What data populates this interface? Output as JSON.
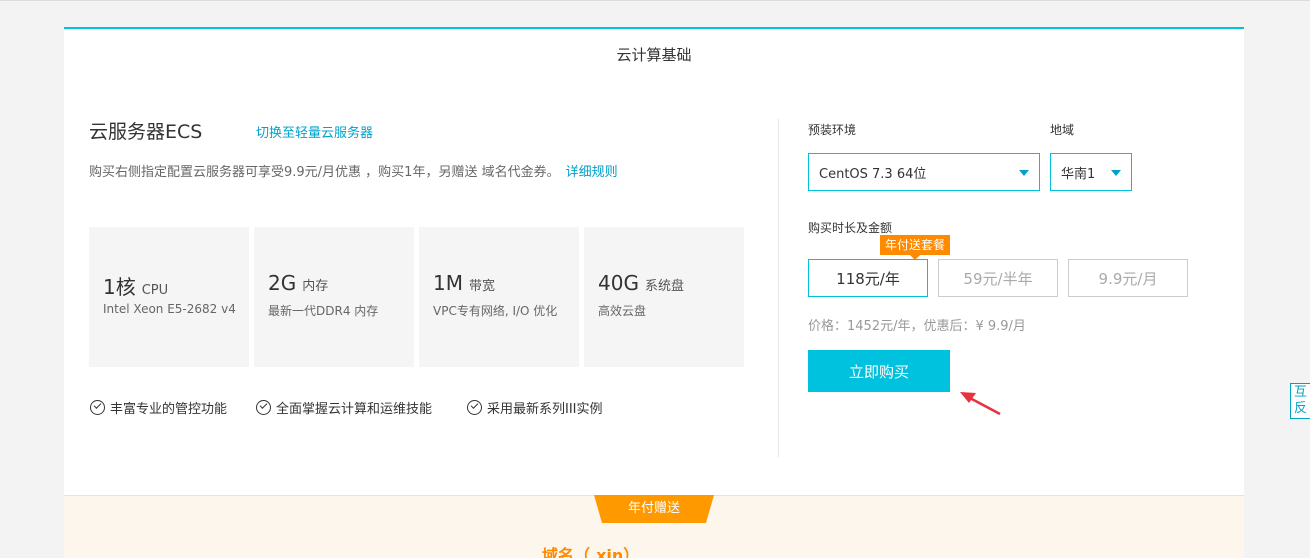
{
  "header": {
    "title": "云计算基础"
  },
  "product": {
    "name": "云服务器ECS",
    "switch_link": "切换至轻量云服务器",
    "promo_text": "购买右侧指定配置云服务器可享受9.9元/月优惠 ，购买1年，另赠送 域名代金券。",
    "promo_link": "详细规则"
  },
  "specs": [
    {
      "value": "1核",
      "unit": "CPU",
      "desc": "Intel Xeon E5-2682 v4"
    },
    {
      "value": "2G",
      "unit": "内存",
      "desc": "最新一代DDR4 内存"
    },
    {
      "value": "1M",
      "unit": "带宽",
      "desc": "VPC专有网络, I/O 优化"
    },
    {
      "value": "40G",
      "unit": "系统盘",
      "desc": "高效云盘"
    }
  ],
  "features": [
    "丰富专业的管控功能",
    "全面掌握云计算和运维技能",
    "采用最新系列III实例"
  ],
  "config": {
    "os_label": "预装环境",
    "os_value": "CentOS 7.3 64位",
    "region_label": "地域",
    "region_value": "华南1",
    "duration_label": "购买时长及金额",
    "badge": "年付送套餐",
    "durations": [
      {
        "label": "118元/年",
        "selected": true
      },
      {
        "label": "59元/半年",
        "selected": false
      },
      {
        "label": "9.9元/月",
        "selected": false
      }
    ],
    "price_line": "价格：1452元/年，优惠后：¥ 9.9/月",
    "buy_button": "立即购买"
  },
  "bottom": {
    "ribbon": "年付赠送",
    "domain": "域名（.xin）"
  },
  "side_tab": "互反",
  "colors": {
    "accent": "#00c1de",
    "link": "#00a2ca",
    "orange": "#ff8a00",
    "arrow": "#e8323c"
  }
}
